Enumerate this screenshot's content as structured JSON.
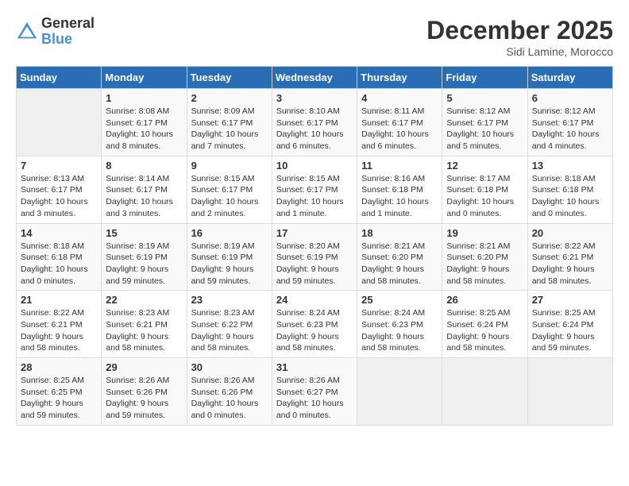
{
  "logo": {
    "general": "General",
    "blue": "Blue"
  },
  "header": {
    "month": "December 2025",
    "location": "Sidi Lamine, Morocco"
  },
  "weekdays": [
    "Sunday",
    "Monday",
    "Tuesday",
    "Wednesday",
    "Thursday",
    "Friday",
    "Saturday"
  ],
  "weeks": [
    [
      {
        "day": "",
        "sunrise": "",
        "sunset": "",
        "daylight": ""
      },
      {
        "day": "1",
        "sunrise": "Sunrise: 8:08 AM",
        "sunset": "Sunset: 6:17 PM",
        "daylight": "Daylight: 10 hours and 8 minutes."
      },
      {
        "day": "2",
        "sunrise": "Sunrise: 8:09 AM",
        "sunset": "Sunset: 6:17 PM",
        "daylight": "Daylight: 10 hours and 7 minutes."
      },
      {
        "day": "3",
        "sunrise": "Sunrise: 8:10 AM",
        "sunset": "Sunset: 6:17 PM",
        "daylight": "Daylight: 10 hours and 6 minutes."
      },
      {
        "day": "4",
        "sunrise": "Sunrise: 8:11 AM",
        "sunset": "Sunset: 6:17 PM",
        "daylight": "Daylight: 10 hours and 6 minutes."
      },
      {
        "day": "5",
        "sunrise": "Sunrise: 8:12 AM",
        "sunset": "Sunset: 6:17 PM",
        "daylight": "Daylight: 10 hours and 5 minutes."
      },
      {
        "day": "6",
        "sunrise": "Sunrise: 8:12 AM",
        "sunset": "Sunset: 6:17 PM",
        "daylight": "Daylight: 10 hours and 4 minutes."
      }
    ],
    [
      {
        "day": "7",
        "sunrise": "Sunrise: 8:13 AM",
        "sunset": "Sunset: 6:17 PM",
        "daylight": "Daylight: 10 hours and 3 minutes."
      },
      {
        "day": "8",
        "sunrise": "Sunrise: 8:14 AM",
        "sunset": "Sunset: 6:17 PM",
        "daylight": "Daylight: 10 hours and 3 minutes."
      },
      {
        "day": "9",
        "sunrise": "Sunrise: 8:15 AM",
        "sunset": "Sunset: 6:17 PM",
        "daylight": "Daylight: 10 hours and 2 minutes."
      },
      {
        "day": "10",
        "sunrise": "Sunrise: 8:15 AM",
        "sunset": "Sunset: 6:17 PM",
        "daylight": "Daylight: 10 hours and 1 minute."
      },
      {
        "day": "11",
        "sunrise": "Sunrise: 8:16 AM",
        "sunset": "Sunset: 6:18 PM",
        "daylight": "Daylight: 10 hours and 1 minute."
      },
      {
        "day": "12",
        "sunrise": "Sunrise: 8:17 AM",
        "sunset": "Sunset: 6:18 PM",
        "daylight": "Daylight: 10 hours and 0 minutes."
      },
      {
        "day": "13",
        "sunrise": "Sunrise: 8:18 AM",
        "sunset": "Sunset: 6:18 PM",
        "daylight": "Daylight: 10 hours and 0 minutes."
      }
    ],
    [
      {
        "day": "14",
        "sunrise": "Sunrise: 8:18 AM",
        "sunset": "Sunset: 6:18 PM",
        "daylight": "Daylight: 10 hours and 0 minutes."
      },
      {
        "day": "15",
        "sunrise": "Sunrise: 8:19 AM",
        "sunset": "Sunset: 6:19 PM",
        "daylight": "Daylight: 9 hours and 59 minutes."
      },
      {
        "day": "16",
        "sunrise": "Sunrise: 8:19 AM",
        "sunset": "Sunset: 6:19 PM",
        "daylight": "Daylight: 9 hours and 59 minutes."
      },
      {
        "day": "17",
        "sunrise": "Sunrise: 8:20 AM",
        "sunset": "Sunset: 6:19 PM",
        "daylight": "Daylight: 9 hours and 59 minutes."
      },
      {
        "day": "18",
        "sunrise": "Sunrise: 8:21 AM",
        "sunset": "Sunset: 6:20 PM",
        "daylight": "Daylight: 9 hours and 58 minutes."
      },
      {
        "day": "19",
        "sunrise": "Sunrise: 8:21 AM",
        "sunset": "Sunset: 6:20 PM",
        "daylight": "Daylight: 9 hours and 58 minutes."
      },
      {
        "day": "20",
        "sunrise": "Sunrise: 8:22 AM",
        "sunset": "Sunset: 6:21 PM",
        "daylight": "Daylight: 9 hours and 58 minutes."
      }
    ],
    [
      {
        "day": "21",
        "sunrise": "Sunrise: 8:22 AM",
        "sunset": "Sunset: 6:21 PM",
        "daylight": "Daylight: 9 hours and 58 minutes."
      },
      {
        "day": "22",
        "sunrise": "Sunrise: 8:23 AM",
        "sunset": "Sunset: 6:21 PM",
        "daylight": "Daylight: 9 hours and 58 minutes."
      },
      {
        "day": "23",
        "sunrise": "Sunrise: 8:23 AM",
        "sunset": "Sunset: 6:22 PM",
        "daylight": "Daylight: 9 hours and 58 minutes."
      },
      {
        "day": "24",
        "sunrise": "Sunrise: 8:24 AM",
        "sunset": "Sunset: 6:23 PM",
        "daylight": "Daylight: 9 hours and 58 minutes."
      },
      {
        "day": "25",
        "sunrise": "Sunrise: 8:24 AM",
        "sunset": "Sunset: 6:23 PM",
        "daylight": "Daylight: 9 hours and 58 minutes."
      },
      {
        "day": "26",
        "sunrise": "Sunrise: 8:25 AM",
        "sunset": "Sunset: 6:24 PM",
        "daylight": "Daylight: 9 hours and 58 minutes."
      },
      {
        "day": "27",
        "sunrise": "Sunrise: 8:25 AM",
        "sunset": "Sunset: 6:24 PM",
        "daylight": "Daylight: 9 hours and 59 minutes."
      }
    ],
    [
      {
        "day": "28",
        "sunrise": "Sunrise: 8:25 AM",
        "sunset": "Sunset: 6:25 PM",
        "daylight": "Daylight: 9 hours and 59 minutes."
      },
      {
        "day": "29",
        "sunrise": "Sunrise: 8:26 AM",
        "sunset": "Sunset: 6:26 PM",
        "daylight": "Daylight: 9 hours and 59 minutes."
      },
      {
        "day": "30",
        "sunrise": "Sunrise: 8:26 AM",
        "sunset": "Sunset: 6:26 PM",
        "daylight": "Daylight: 10 hours and 0 minutes."
      },
      {
        "day": "31",
        "sunrise": "Sunrise: 8:26 AM",
        "sunset": "Sunset: 6:27 PM",
        "daylight": "Daylight: 10 hours and 0 minutes."
      },
      {
        "day": "",
        "sunrise": "",
        "sunset": "",
        "daylight": ""
      },
      {
        "day": "",
        "sunrise": "",
        "sunset": "",
        "daylight": ""
      },
      {
        "day": "",
        "sunrise": "",
        "sunset": "",
        "daylight": ""
      }
    ]
  ]
}
